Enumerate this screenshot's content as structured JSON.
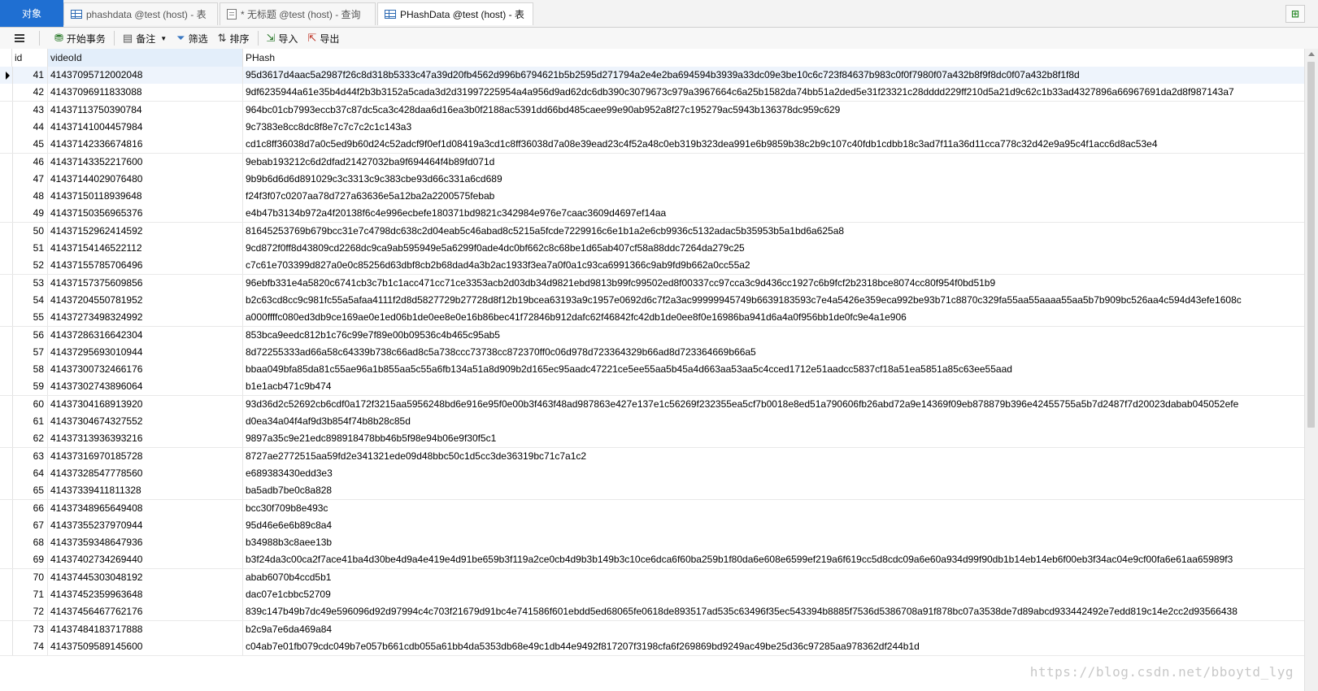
{
  "tabs": [
    {
      "label": "对象"
    },
    {
      "label": "phashdata @test (host) - 表"
    },
    {
      "label": "* 无标题 @test (host) - 查询"
    },
    {
      "label": "PHashData @test (host) - 表"
    }
  ],
  "toolbar": {
    "begin_transaction": "开始事务",
    "memo": "备注",
    "filter": "筛选",
    "sort": "排序",
    "import": "导入",
    "export": "导出"
  },
  "columns": {
    "id": "id",
    "videoId": "videoId",
    "phash": "PHash"
  },
  "rows": [
    {
      "id": "41",
      "videoId": "41437095712002048",
      "phash": "95d3617d4aac5a2987f26c8d318b5333c47a39d20fb4562d996b6794621b5b2595d271794a2e4e2ba694594b3939a33dc09e3be10c6c723f84637b983c0f0f7980f07a432b8f9f8dc0f07a432b8f1f8d"
    },
    {
      "id": "42",
      "videoId": "41437096911833088",
      "phash": "9df6235944a61e35b4d44f2b3b3152a5cada3d2d31997225954a4a956d9ad62dc6db390c3079673c979a3967664c6a25b1582da74bb51a2ded5e31f23321c28dddd229ff210d5a21d9c62c1b33ad4327896a66967691da2d8f987143a7"
    },
    {
      "id": "43",
      "videoId": "41437113750390784",
      "phash": "964bc01cb7993eccb37c87dc5ca3c428daa6d16ea3b0f2188ac5391dd66bd485caee99e90ab952a8f27c195279ac5943b136378dc959c629"
    },
    {
      "id": "44",
      "videoId": "41437141004457984",
      "phash": "9c7383e8cc8dc8f8e7c7c7c2c1c143a3"
    },
    {
      "id": "45",
      "videoId": "41437142336674816",
      "phash": "cd1c8ff36038d7a0c5ed9b60d24c52adcf9f0ef1d08419a3cd1c8ff36038d7a08e39ead23c4f52a48c0eb319b323dea991e6b9859b38c2b9c107c40fdb1cdbb18c3ad7f11a36d11cca778c32d42e9a95c4f1acc6d8ac53e4"
    },
    {
      "id": "46",
      "videoId": "41437143352217600",
      "phash": "9ebab193212c6d2dfad21427032ba9f694464f4b89fd071d"
    },
    {
      "id": "47",
      "videoId": "41437144029076480",
      "phash": "9b9b6d6d6d891029c3c3313c9c383cbe93d66c331a6cd689"
    },
    {
      "id": "48",
      "videoId": "41437150118939648",
      "phash": "f24f3f07c0207aa78d727a63636e5a12ba2a2200575febab"
    },
    {
      "id": "49",
      "videoId": "41437150356965376",
      "phash": "e4b47b3134b972a4f20138f6c4e996ecbefe180371bd9821c342984e976e7caac3609d4697ef14aa"
    },
    {
      "id": "50",
      "videoId": "41437152962414592",
      "phash": "81645253769b679bcc31e7c4798dc638c2d04eab5c46abad8c5215a5fcde7229916c6e1b1a2e6cb9936c5132adac5b35953b5a1bd6a625a8"
    },
    {
      "id": "51",
      "videoId": "41437154146522112",
      "phash": "9cd872f0ff8d43809cd2268dc9ca9ab595949e5a6299f0ade4dc0bf662c8c68be1d65ab407cf58a88ddc7264da279c25"
    },
    {
      "id": "52",
      "videoId": "41437155785706496",
      "phash": "c7c61e703399d827a0e0c85256d63dbf8cb2b68dad4a3b2ac1933f3ea7a0f0a1c93ca6991366c9ab9fd9b662a0cc55a2"
    },
    {
      "id": "53",
      "videoId": "41437157375609856",
      "phash": "96ebfb331e4a5820c6741cb3c7b1c1acc471cc71ce3353acb2d03db34d9821ebd9813b99fc99502ed8f00337cc97cca3c9d436cc1927c6b9fcf2b2318bce8074cc80f954f0bd51b9"
    },
    {
      "id": "54",
      "videoId": "41437204550781952",
      "phash": "b2c63cd8cc9c981fc55a5afaa4111f2d8d5827729b27728d8f12b19bcea63193a9c1957e0692d6c7f2a3ac99999945749b6639183593c7e4a5426e359eca992be93b71c8870c329fa55aa55aaaa55aa5b7b909bc526aa4c594d43efe1608c"
    },
    {
      "id": "55",
      "videoId": "41437273498324992",
      "phash": "a000ffffc080ed3db9ce169ae0e1ed06b1de0ee8e0e16b86bec41f72846b912dafc62f46842fc42db1de0ee8f0e16986ba941d6a4a0f956bb1de0fc9e4a1e906"
    },
    {
      "id": "56",
      "videoId": "41437286316642304",
      "phash": "853bca9eedc812b1c76c99e7f89e00b09536c4b465c95ab5"
    },
    {
      "id": "57",
      "videoId": "41437295693010944",
      "phash": "8d72255333ad66a58c64339b738c66ad8c5a738ccc73738cc872370ff0c06d978d723364329b66ad8d723364669b66a5"
    },
    {
      "id": "58",
      "videoId": "41437300732466176",
      "phash": "bbaa049bfa85da81c55ae96a1b855aa5c55a6fb134a51a8d909b2d165ec95aadc47221ce5ee55aa5b45a4d663aa53aa5c4cced1712e51aadcc5837cf18a51ea5851a85c63ee55aad"
    },
    {
      "id": "59",
      "videoId": "41437302743896064",
      "phash": "b1e1acb471c9b474"
    },
    {
      "id": "60",
      "videoId": "41437304168913920",
      "phash": "93d36d2c52692cb6cdf0a172f3215aa5956248bd6e916e95f0e00b3f463f48ad987863e427e137e1c56269f232355ea5cf7b0018e8ed51a790606fb26abd72a9e14369f09eb878879b396e42455755a5b7d2487f7d20023dabab045052efe"
    },
    {
      "id": "61",
      "videoId": "41437304674327552",
      "phash": "d0ea34a04f4af9d3b854f74b8b28c85d"
    },
    {
      "id": "62",
      "videoId": "41437313936393216",
      "phash": "9897a35c9e21edc898918478bb46b5f98e94b06e9f30f5c1"
    },
    {
      "id": "63",
      "videoId": "41437316970185728",
      "phash": "8727ae2772515aa59fd2e341321ede09d48bbc50c1d5cc3de36319bc71c7a1c2"
    },
    {
      "id": "64",
      "videoId": "41437328547778560",
      "phash": "e689383430edd3e3"
    },
    {
      "id": "65",
      "videoId": "41437339411811328",
      "phash": "ba5adb7be0c8a828"
    },
    {
      "id": "66",
      "videoId": "41437348965649408",
      "phash": "bcc30f709b8e493c"
    },
    {
      "id": "67",
      "videoId": "41437355237970944",
      "phash": "95d46e6e6b89c8a4"
    },
    {
      "id": "68",
      "videoId": "41437359348647936",
      "phash": "b34988b3c8aee13b"
    },
    {
      "id": "69",
      "videoId": "41437402734269440",
      "phash": "b3f24da3c00ca2f7ace41ba4d30be4d9a4e419e4d91be659b3f119a2ce0cb4d9b3b149b3c10ce6dca6f60ba259b1f80da6e608e6599ef219a6f619cc5d8cdc09a6e60a934d99f90db1b14eb14eb6f00eb3f34ac04e9cf00fa6e61aa65989f3"
    },
    {
      "id": "70",
      "videoId": "41437445303048192",
      "phash": "abab6070b4ccd5b1"
    },
    {
      "id": "71",
      "videoId": "41437452359963648",
      "phash": "dac07e1cbbc52709"
    },
    {
      "id": "72",
      "videoId": "41437456467762176",
      "phash": "839c147b49b7dc49e596096d92d97994c4c703f21679d91bc4e741586f601ebdd5ed68065fe0618de893517ad535c63496f35ec543394b8885f7536d5386708a91f878bc07a3538de7d89abcd933442492e7edd819c14e2cc2d93566438"
    },
    {
      "id": "73",
      "videoId": "41437484183717888",
      "phash": "b2c9a7e6da469a84"
    },
    {
      "id": "74",
      "videoId": "41437509589145600",
      "phash": "c04ab7e01fb079cdc049b7e057b661cdb055a61bb4da5353db68e49c1db44e9492f817207f3198cfa6f269869bd9249ac49be25d36c97285aa978362df244b1d"
    }
  ],
  "watermark": "https://blog.csdn.net/bboytd_lyg",
  "colors": {
    "objects_tab": "#1f6fd2",
    "selected_row": "#eef4fc"
  }
}
